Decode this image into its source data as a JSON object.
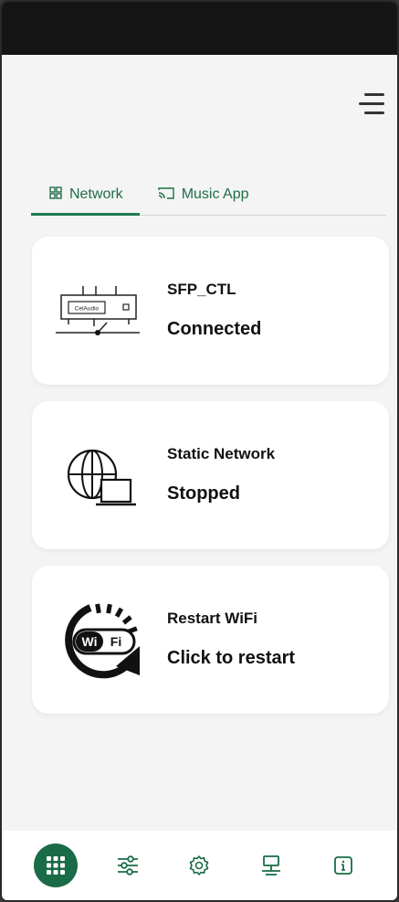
{
  "colors": {
    "accent": "#1a6b47",
    "card_bg": "#ffffff",
    "page_bg": "#f4f4f5",
    "status_bar": "#151515"
  },
  "header": {
    "menu_icon": "hamburger-menu-icon"
  },
  "tabs": [
    {
      "label": "Network",
      "icon": "grid-icon",
      "active": true
    },
    {
      "label": "Music App",
      "icon": "cast-icon",
      "active": false
    }
  ],
  "cards": [
    {
      "title": "SFP_CTL",
      "status": "Connected",
      "icon": "device-icon",
      "device_brand": "CelAudio"
    },
    {
      "title": "Static Network",
      "status": "Stopped",
      "icon": "globe-laptop-icon"
    },
    {
      "title": "Restart WiFi",
      "status": "Click to restart",
      "icon": "wifi-restart-icon",
      "icon_text": "WiFi"
    }
  ],
  "bottom_nav": [
    {
      "icon": "apps-grid-icon",
      "active": true
    },
    {
      "icon": "sliders-icon",
      "active": false
    },
    {
      "icon": "gear-icon",
      "active": false
    },
    {
      "icon": "network-icon",
      "active": false
    },
    {
      "icon": "info-icon",
      "active": false
    }
  ]
}
